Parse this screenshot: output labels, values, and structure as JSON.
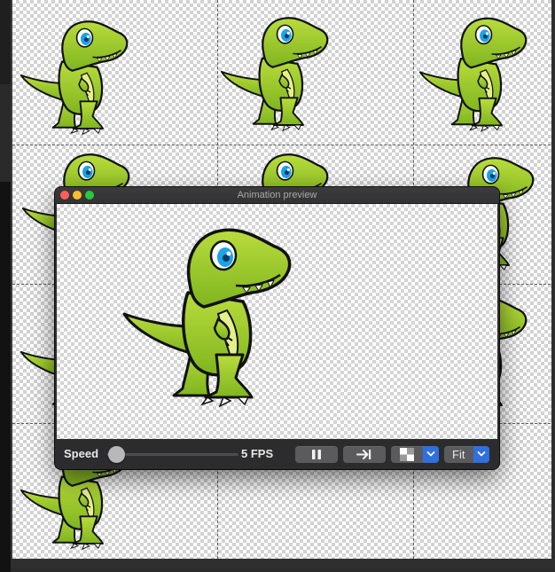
{
  "window": {
    "title": "Animation preview"
  },
  "toolbar": {
    "speed_label": "Speed",
    "speed_fraction": 0.0,
    "fps_label": "5 FPS",
    "play_pause_icon": "pause-icon",
    "step_icon": "step-forward-icon",
    "background_icon": "checkerboard-icon",
    "zoom_value": "Fit"
  },
  "colors": {
    "accent": "#2f6fe0",
    "dino_body": "#9ccc2a",
    "dino_belly": "#e6f08a",
    "dino_eye": "#1aa3e8"
  }
}
